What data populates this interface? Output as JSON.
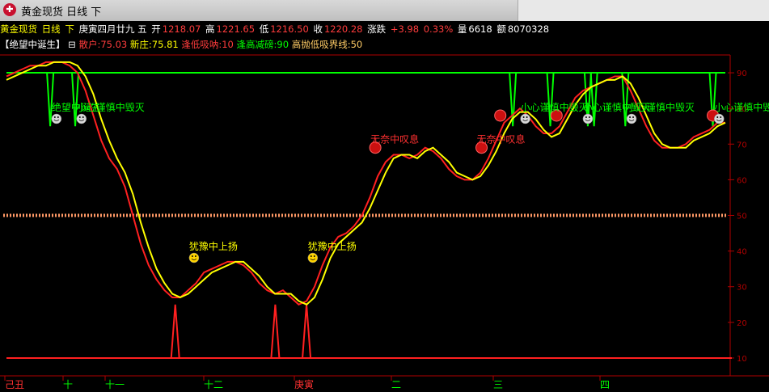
{
  "window": {
    "title": "黄金现货 日线 下"
  },
  "info_bar": {
    "instrument": "黄金现货",
    "period": "日线",
    "mode": "下",
    "date": "庚寅四月廿九 五",
    "open_label": "开",
    "open": "1218.07",
    "high_label": "高",
    "high": "1221.65",
    "low_label": "低",
    "low": "1216.50",
    "close_label": "收",
    "close": "1220.28",
    "change_label": "涨跌",
    "change": "+3.98",
    "change_pct": "0.33%",
    "volume_label": "量",
    "volume": "6618",
    "amount_label": "额",
    "amount": "8070328"
  },
  "legend": {
    "indicator": "【绝望中诞生】",
    "toggle": "⊟",
    "retail": "散户:75.03",
    "banker": "新庄:75.81",
    "buy_low": "逢低吸呐:10",
    "sell_high": "逢高减磅:90",
    "threshold": "高抛低吸界线:50"
  },
  "colors": {
    "background": "#000000",
    "red_line": "#ff2020",
    "yellow_line": "#ffff00",
    "green_line": "#00ff00",
    "axis": "#b00000",
    "dotted": "#ff9966"
  },
  "chart_data": {
    "type": "line",
    "ylim": [
      5,
      95
    ],
    "yticks": [
      10,
      20,
      30,
      40,
      50,
      60,
      70,
      80,
      90
    ],
    "x_labels": [
      "己丑",
      "十",
      "十一",
      "十二",
      "庚寅",
      "二",
      "三",
      "四"
    ],
    "series": [
      {
        "name": "散户",
        "color": "#ff2020",
        "values": [
          89,
          90,
          91,
          92,
          92,
          93,
          93,
          93,
          92,
          90,
          85,
          78,
          71,
          66,
          63,
          58,
          50,
          42,
          36,
          32,
          29,
          27,
          27,
          29,
          31,
          34,
          35,
          36,
          37,
          37,
          36,
          34,
          31,
          29,
          28,
          29,
          27,
          25,
          26,
          30,
          36,
          41,
          44,
          45,
          47,
          50,
          55,
          61,
          65,
          67,
          67,
          66,
          67,
          69,
          68,
          66,
          63,
          61,
          60,
          60,
          62,
          66,
          71,
          76,
          78,
          80,
          78,
          75,
          73,
          73,
          75,
          79,
          83,
          85,
          86,
          87,
          88,
          89,
          89,
          85,
          80,
          75,
          71,
          69,
          69,
          69,
          70,
          72,
          73,
          74,
          76,
          76
        ]
      },
      {
        "name": "新庄",
        "color": "#ffff00",
        "values": [
          88,
          89,
          90,
          91,
          92,
          92,
          93,
          93,
          93,
          92,
          89,
          84,
          77,
          71,
          66,
          62,
          56,
          48,
          41,
          35,
          31,
          28,
          27,
          28,
          30,
          32,
          34,
          35,
          36,
          37,
          37,
          35,
          33,
          30,
          28,
          28,
          28,
          26,
          25,
          27,
          32,
          38,
          42,
          44,
          46,
          48,
          52,
          57,
          62,
          66,
          67,
          67,
          66,
          68,
          69,
          67,
          65,
          62,
          61,
          60,
          61,
          64,
          68,
          73,
          77,
          79,
          79,
          77,
          74,
          72,
          73,
          77,
          81,
          84,
          86,
          87,
          88,
          88,
          89,
          87,
          83,
          78,
          73,
          70,
          69,
          69,
          69,
          71,
          72,
          73,
          75,
          76
        ]
      },
      {
        "name": "逢高减磅",
        "color": "#00ff00",
        "values": [
          90,
          90,
          90,
          90,
          90,
          90,
          90,
          90,
          90,
          90,
          90,
          90,
          90,
          90,
          90,
          90,
          90,
          90,
          90,
          90,
          90,
          90,
          90,
          90,
          90,
          90,
          90,
          90,
          90,
          90,
          90,
          90,
          90,
          90,
          90,
          90,
          90,
          90,
          90,
          90,
          90,
          90,
          90,
          90,
          90,
          90,
          90,
          90,
          90,
          90,
          90,
          90,
          90,
          90,
          90,
          90,
          90,
          90,
          90,
          90,
          90,
          90,
          90,
          90,
          90,
          90,
          90,
          90,
          90,
          90,
          90,
          90,
          90,
          90,
          90,
          90,
          90,
          90,
          90,
          90,
          90,
          90,
          90,
          90,
          90,
          90,
          90,
          90,
          90,
          90,
          90,
          90
        ],
        "spikes": [
          [
            7,
            75
          ],
          [
            11,
            75
          ],
          [
            81,
            75
          ],
          [
            87,
            75
          ],
          [
            93,
            75
          ],
          [
            94,
            75
          ],
          [
            99,
            75
          ],
          [
            113,
            75
          ]
        ]
      },
      {
        "name": "逢低吸呐",
        "color": "#ff2020",
        "value": 10,
        "spikes": [
          [
            27,
            25
          ],
          [
            43,
            25
          ],
          [
            48,
            25
          ]
        ]
      }
    ],
    "annotations": [
      {
        "text": "绝望中诞生",
        "kind": "green",
        "x": 8,
        "y": 78
      },
      {
        "text": "小心谨慎中毁灭",
        "kind": "green",
        "x": 12,
        "y": 78
      },
      {
        "text": "犹豫中上扬",
        "kind": "yellow",
        "x": 30,
        "y": 39
      },
      {
        "text": "犹豫中上扬",
        "kind": "yellow",
        "x": 49,
        "y": 39
      },
      {
        "text": "无奈中叹息",
        "kind": "red",
        "x": 59,
        "y": 69
      },
      {
        "text": "无奈中叹息",
        "kind": "red",
        "x": 76,
        "y": 69
      },
      {
        "text": "小心谨慎中毁灭",
        "kind": "green",
        "x": 83,
        "y": 78
      },
      {
        "text": "小心谨慎中毁灭",
        "kind": "green",
        "x": 93,
        "y": 78
      },
      {
        "text": "小心谨慎中毁灭",
        "kind": "green",
        "x": 100,
        "y": 78
      },
      {
        "text": "小心谨慎中毁灭",
        "kind": "green",
        "x": 114,
        "y": 78
      }
    ],
    "red_markers": [
      [
        59,
        69
      ],
      [
        76,
        69
      ],
      [
        79,
        78
      ],
      [
        88,
        78
      ],
      [
        113,
        78
      ]
    ],
    "threshold_line": 50
  }
}
